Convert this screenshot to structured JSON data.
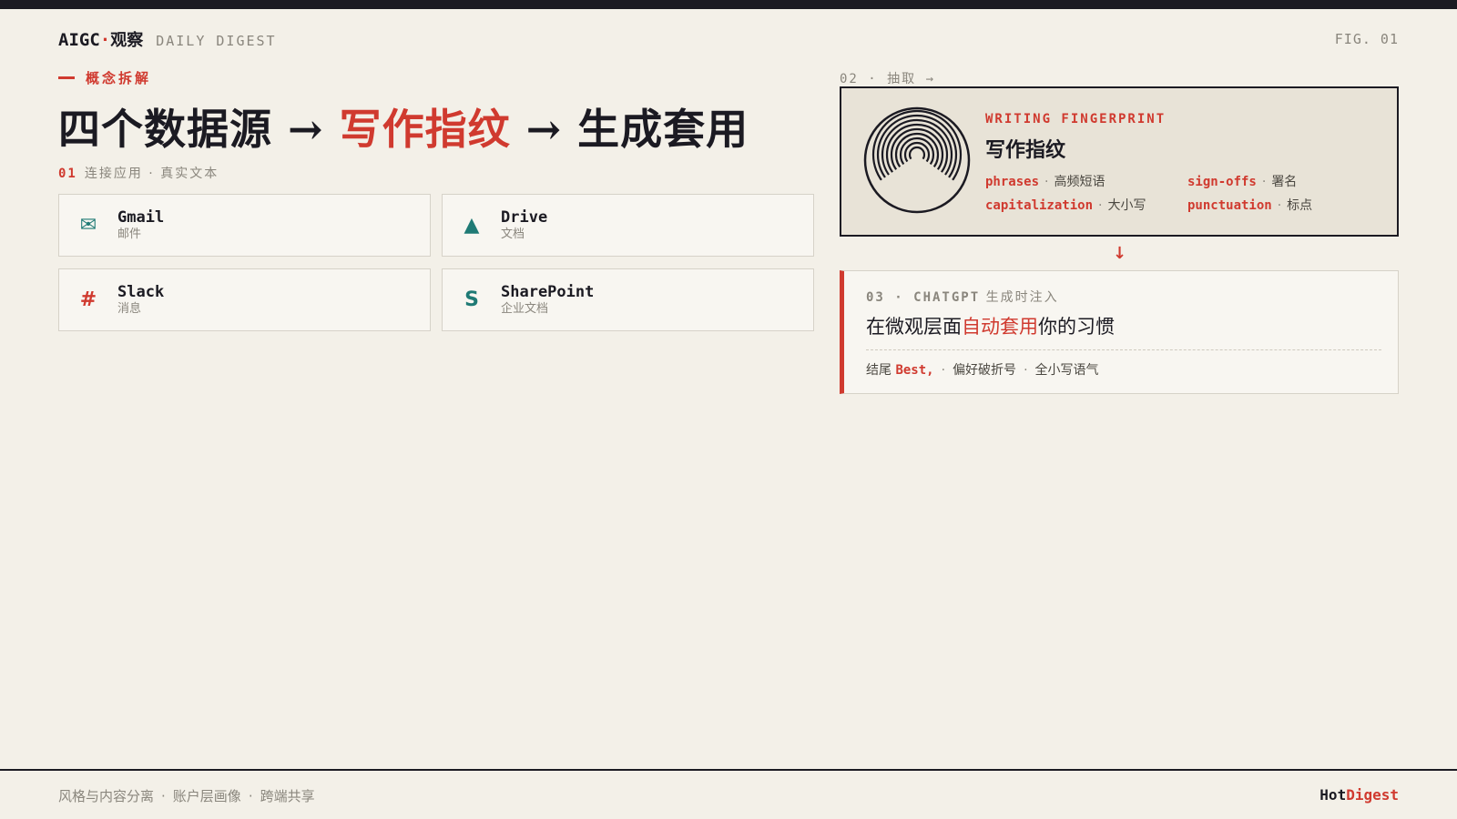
{
  "header": {
    "brand_name": "AIGC",
    "brand_dot": "·",
    "brand_cn": "观察",
    "brand_sub": "DAILY DIGEST",
    "fig_label": "FIG. 01"
  },
  "kicker": "概念拆解",
  "headline": {
    "part1": "四个数据源 → ",
    "accent": "写作指纹",
    "part2": " → 生成套用"
  },
  "step1": {
    "number": "01",
    "label": "连接应用 · 真实文本"
  },
  "sources": [
    {
      "name": "Gmail",
      "sub": "邮件",
      "icon": "envelope-icon",
      "glyph": "✉"
    },
    {
      "name": "Drive",
      "sub": "文档",
      "icon": "triangle-icon",
      "glyph": "▲"
    },
    {
      "name": "Slack",
      "sub": "消息",
      "icon": "hash-icon",
      "glyph": "#"
    },
    {
      "name": "SharePoint",
      "sub": "企业文档",
      "icon": "letter-s-icon",
      "glyph": "S"
    }
  ],
  "step2": {
    "label": "02 · 抽取 →"
  },
  "fingerprint": {
    "kicker": "WRITING FINGERPRINT",
    "title": "写作指纹",
    "traits": [
      {
        "key": "phrases",
        "sep": "·",
        "desc": "高频短语"
      },
      {
        "key": "sign-offs",
        "sep": "·",
        "desc": "署名"
      },
      {
        "key": "capitalization",
        "sep": "·",
        "desc": "大小写"
      },
      {
        "key": "punctuation",
        "sep": "·",
        "desc": "标点"
      }
    ]
  },
  "arrow": "↓",
  "generation": {
    "kicker_mono": "03 · CHATGPT",
    "kicker_cn": "生成时注入",
    "title_pre": "在微观层面",
    "title_accent": "自动套用",
    "title_post": "你的习惯",
    "note_prefix": "结尾",
    "note_best": "Best,",
    "note_2": "偏好破折号",
    "note_3": "全小写语气",
    "sep": "·"
  },
  "footer": {
    "items": [
      "风格与内容分离",
      "账户层画像",
      "跨端共享"
    ],
    "sep": "·",
    "brand_hot": "Hot",
    "brand_digest": "Digest"
  },
  "colors": {
    "accent": "#d03a2f",
    "teal": "#1f7a75",
    "ink": "#1b1a22",
    "paper": "#f3f0e8"
  }
}
